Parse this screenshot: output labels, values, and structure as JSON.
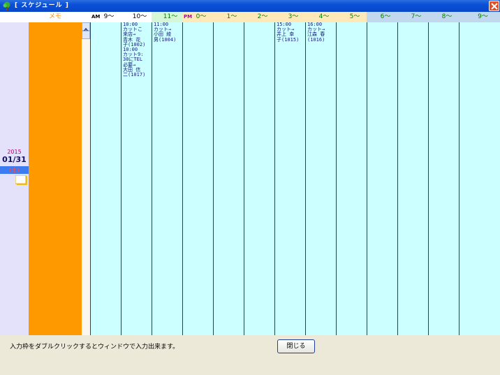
{
  "window": {
    "title": "[ スケジュール ]",
    "close_icon": "close-icon",
    "app_icon": "tree-icon"
  },
  "header": {
    "memo_label": "メモ",
    "am_marker": "AM",
    "pm_marker": "PM",
    "hours": [
      "9～",
      "10～",
      "11～",
      "0～",
      "1～",
      "2～",
      "3～",
      "4～",
      "5～",
      "6～",
      "7～",
      "8～",
      "9～"
    ]
  },
  "date": {
    "year": "2015",
    "month_day": "01/31",
    "weekday": "(土)"
  },
  "schedule": {
    "slots": [
      "",
      "10:00\nカットこ\n来店→\n青木 花\n子(1002)\n10:00\nカット9:\n30にTEL\n必要→\n大田 信\n二(1017)",
      "11:00\nカット→\n小田 綾\n男(1004)",
      "",
      "",
      "",
      "15:00\nカット→\n井上 幸\n子(1015)",
      "16:00\nカット→\n江森 春\n(1016)",
      "",
      "",
      "",
      "",
      ""
    ]
  },
  "footer": {
    "hint": "入力枠をダブルクリックするとウィンドウで入力出来ます。",
    "close_button": "閉じる"
  },
  "colors": {
    "titlebar": "#0a4fd8",
    "memo": "#ff9900",
    "slot_bg": "#ccffff",
    "date_col": "#e4e2fb"
  }
}
